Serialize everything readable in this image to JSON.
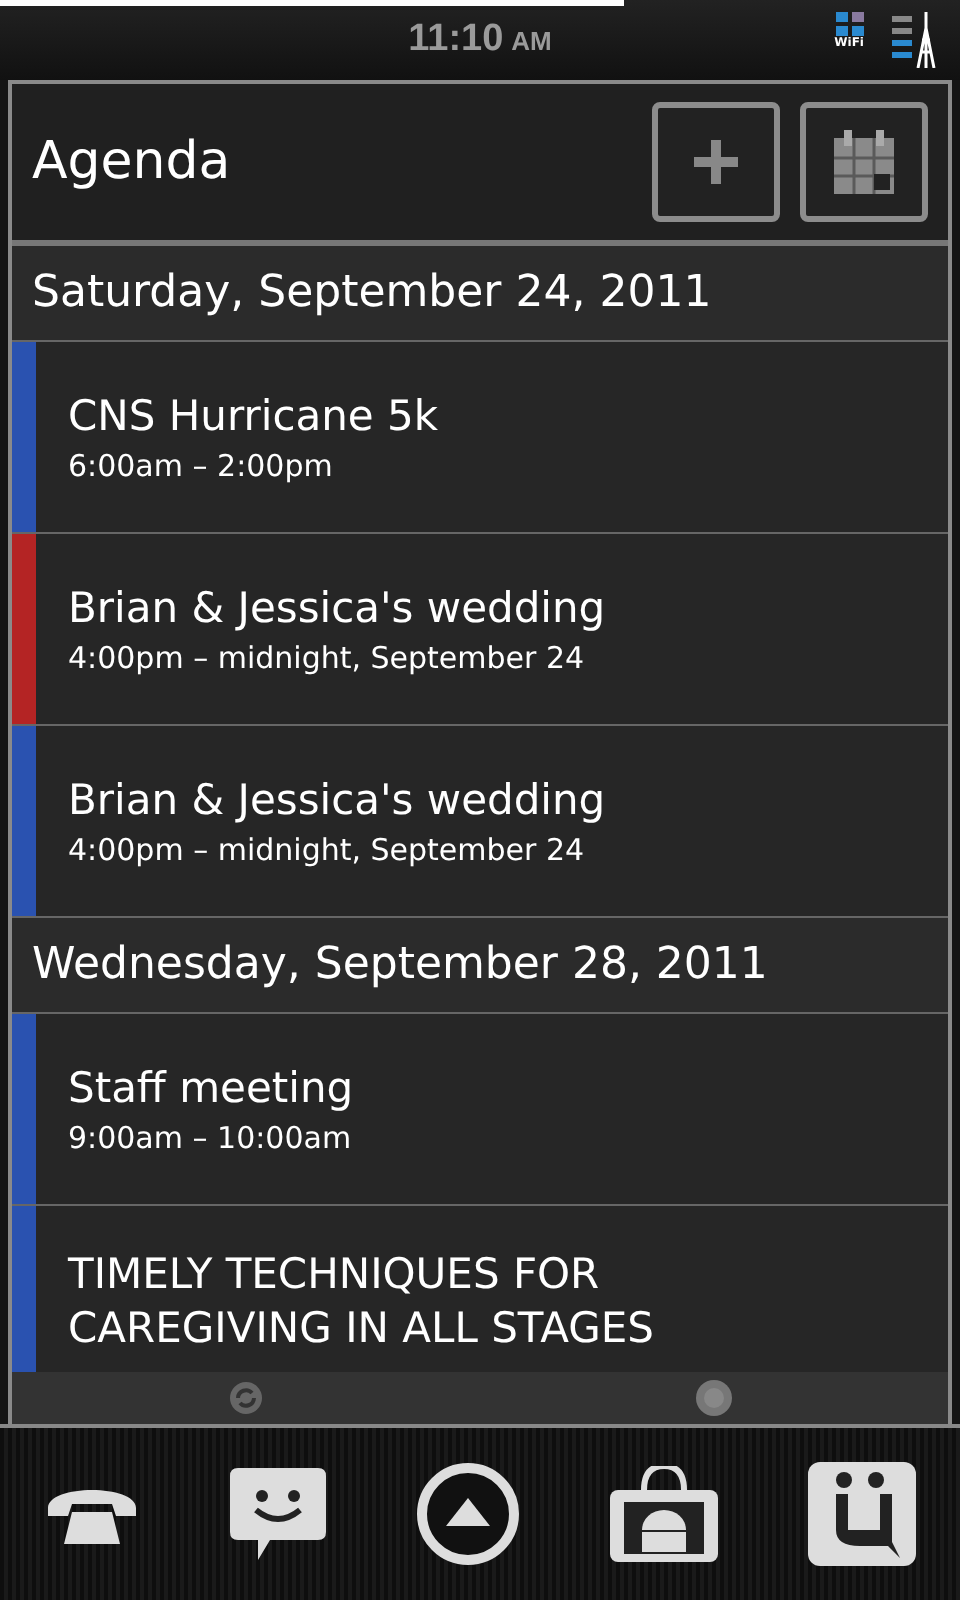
{
  "status_bar": {
    "progress": {
      "level": 0.65
    },
    "time": "11:10",
    "meridiem": "AM",
    "wifi_label": "WiFi"
  },
  "header": {
    "title": "Agenda"
  },
  "days": [
    {
      "date": "Saturday, September 24, 2011",
      "events": [
        {
          "title": "CNS Hurricane 5k",
          "time": "6:00am – 2:00pm",
          "color": "#2a52b0"
        },
        {
          "title": "Brian & Jessica's wedding",
          "time": "4:00pm – midnight, September 24",
          "color": "#b42424"
        },
        {
          "title": "Brian & Jessica's wedding",
          "time": "4:00pm – midnight, September 24",
          "color": "#2a52b0"
        }
      ]
    },
    {
      "date": "Wednesday, September 28, 2011",
      "events": [
        {
          "title": "Staff meeting",
          "time": "9:00am – 10:00am",
          "color": "#2a52b0"
        },
        {
          "title": "TIMELY TECHNIQUES FOR CAREGIVING IN ALL STAGES",
          "color": "#2a52b0"
        }
      ]
    }
  ]
}
